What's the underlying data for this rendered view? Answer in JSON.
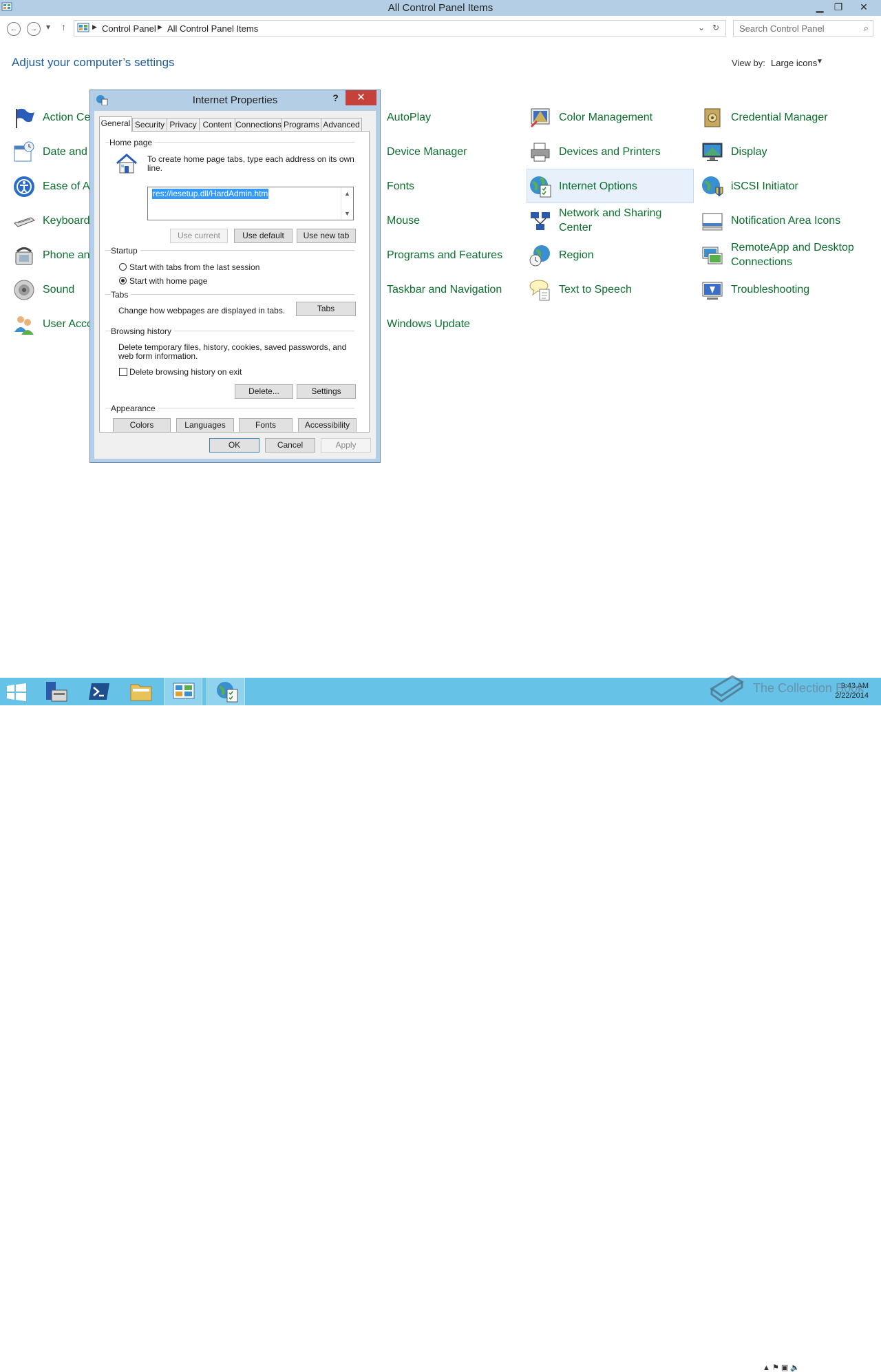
{
  "window": {
    "title": "All Control Panel Items",
    "minimize": "▁",
    "restore": "❐",
    "close": "✕"
  },
  "nav": {
    "back": "←",
    "forward": "→",
    "recent": "▾",
    "up": "↑",
    "breadcrumb": [
      "Control Panel",
      "All Control Panel Items"
    ],
    "search_placeholder": "Search Control Panel",
    "dropdown": "⌄",
    "refresh": "↻",
    "search_icon": "⌕"
  },
  "heading": "Adjust your computer’s settings",
  "view_by": {
    "label": "View by:",
    "value": "Large icons",
    "caret": "▼"
  },
  "items": {
    "col1": [
      "Action Center",
      "Date and Time",
      "Ease of Access Center",
      "Keyboard",
      "Phone and Modem",
      "Sound",
      "User Accounts"
    ],
    "col3": [
      "AutoPlay",
      "Device Manager",
      "Fonts",
      "Mouse",
      "Programs and Features",
      "Taskbar and Navigation",
      "Windows Update"
    ],
    "col4": [
      "Color Management",
      "Devices and Printers",
      "Internet Options",
      "Network and Sharing Center",
      "Region",
      "Text to Speech"
    ],
    "col5": [
      "Credential Manager",
      "Display",
      "iSCSI Initiator",
      "Notification Area Icons",
      "RemoteApp and Desktop Connections",
      "Troubleshooting"
    ]
  },
  "dialog": {
    "title": "Internet Properties",
    "help": "?",
    "close": "✕",
    "tabs": [
      "General",
      "Security",
      "Privacy",
      "Content",
      "Connections",
      "Programs",
      "Advanced"
    ],
    "home_page": {
      "group": "Home page",
      "desc": "To create home page tabs, type each address on its own line.",
      "url": "res://iesetup.dll/HardAdmin.htm",
      "use_current": "Use current",
      "use_default": "Use default",
      "use_new_tab": "Use new tab"
    },
    "startup": {
      "group": "Startup",
      "opt1": "Start with tabs from the last session",
      "opt2": "Start with home page",
      "selected": 2
    },
    "tabs_group": {
      "group": "Tabs",
      "desc": "Change how webpages are displayed in tabs.",
      "button": "Tabs"
    },
    "history": {
      "group": "Browsing history",
      "desc": "Delete temporary files, history, cookies, saved passwords, and web form information.",
      "checkbox": "Delete browsing history on exit",
      "checked": false,
      "delete": "Delete...",
      "settings": "Settings"
    },
    "appearance": {
      "group": "Appearance",
      "colors": "Colors",
      "languages": "Languages",
      "fonts": "Fonts",
      "accessibility": "Accessibility"
    },
    "ok": "OK",
    "cancel": "Cancel",
    "apply": "Apply"
  },
  "taskbar": {
    "time": "9:43 AM",
    "date": "2/22/2014",
    "watermark": "The Collection Book",
    "tray": "▲ ⚑ ▣ 🔈"
  },
  "colors": {
    "accent": "#1e5a9c",
    "link_green": "#0b6f2e",
    "taskbar": "#66c2e6",
    "titlebar": "#b4cfe5"
  }
}
